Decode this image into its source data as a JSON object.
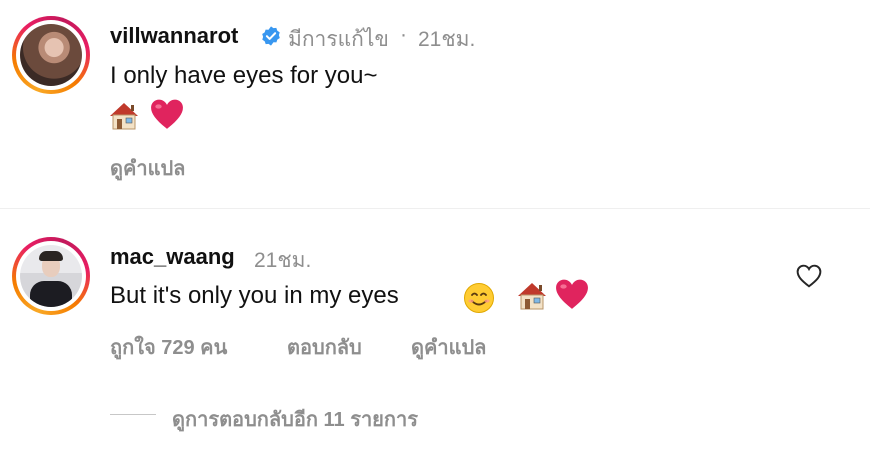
{
  "comment1": {
    "username": "villwannarot",
    "edited_label": "มีการแก้ไข",
    "separator": "·",
    "time": "21ชม.",
    "text": "I only have eyes for you~",
    "emojis": [
      "house-emoji",
      "red-heart-emoji"
    ],
    "translate_label": "ดูคำแปล"
  },
  "comment2": {
    "username": "mac_waang",
    "time": "21ชม.",
    "text": "But it's only you in my eyes",
    "emojis": [
      "smiling-face-emoji",
      "house-emoji",
      "red-heart-emoji"
    ],
    "likes_label": "ถูกใจ 729 คน",
    "reply_label": "ตอบกลับ",
    "translate_label": "ดูคำแปล"
  },
  "view_replies_label": "ดูการตอบกลับอีก 11 รายการ",
  "colors": {
    "verified": "#3897f0",
    "meta": "#8e8e8e",
    "heart": "#e0245e"
  },
  "icons": [
    "verified-badge-icon",
    "like-heart-icon"
  ]
}
